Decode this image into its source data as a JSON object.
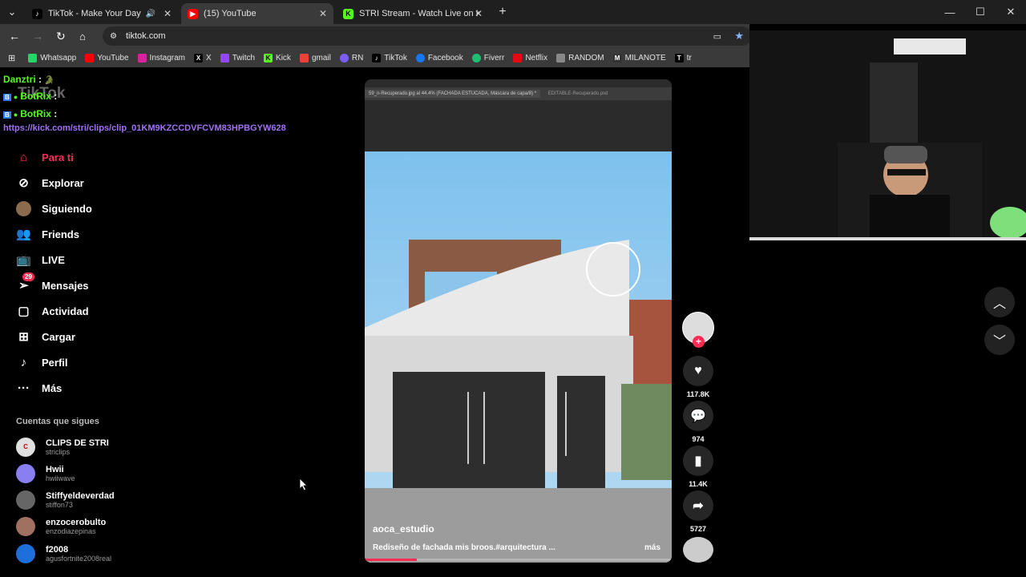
{
  "tabs": [
    {
      "title": "TikTok - Make Your Day",
      "icon": "tiktok-icon"
    },
    {
      "title": "(15) YouTube",
      "icon": "youtube-icon"
    },
    {
      "title": "STRI Stream - Watch Live on Ki",
      "icon": "kick-icon"
    }
  ],
  "url": "tiktok.com",
  "bookmarks": [
    "Whatsapp",
    "YouTube",
    "Instagram",
    "X",
    "Twitch",
    "Kick",
    "gmail",
    "RN",
    "TikTok",
    "Facebook",
    "Fiverr",
    "Netflix",
    "RANDOM",
    "MILANOTE",
    "tr"
  ],
  "chat": {
    "lines": [
      {
        "user": "Danztri",
        "text": ":"
      },
      {
        "user": "BotRix",
        "text": ":"
      },
      {
        "user": "BotRix",
        "text": ":"
      }
    ],
    "link": "https://kick.com/stri/clips/clip_01KM9KZCCDVFCVM83HPBGYW628"
  },
  "nav": [
    {
      "label": "Para ti",
      "icon": "home-icon",
      "active": true
    },
    {
      "label": "Explorar",
      "icon": "compass-icon"
    },
    {
      "label": "Siguiendo",
      "icon": "following-avatar-icon"
    },
    {
      "label": "Friends",
      "icon": "friends-icon"
    },
    {
      "label": "LIVE",
      "icon": "live-icon"
    },
    {
      "label": "Mensajes",
      "icon": "messages-icon",
      "badge": "29"
    },
    {
      "label": "Actividad",
      "icon": "activity-icon"
    },
    {
      "label": "Cargar",
      "icon": "upload-icon"
    },
    {
      "label": "Perfil",
      "icon": "profile-icon"
    },
    {
      "label": "Más",
      "icon": "more-icon"
    }
  ],
  "following": {
    "heading": "Cuentas que sigues",
    "accounts": [
      {
        "name": "CLIPS DE STRI",
        "handle": "striclips"
      },
      {
        "name": "Hwii",
        "handle": "hwiiwave"
      },
      {
        "name": "Stiffyeldeverdad",
        "handle": "stiffon73"
      },
      {
        "name": "enzocerobulto",
        "handle": "enzodiazepinas"
      },
      {
        "name": "f2008",
        "handle": "agusfortnite2008real"
      }
    ]
  },
  "video": {
    "ps_tab1": "59_n-Recuperado.jpg al 44.4% (FACHADA ESTUCADA, Máscara de capa/8) *",
    "ps_tab2": "EDITABLE-Recuperado.psd",
    "author": "aoca_estudio",
    "caption": "Rediseño de fachada mis broos.#arquitectura ...",
    "more": "más",
    "progress": 0.17
  },
  "actions": {
    "likes": "117.8K",
    "comments": "974",
    "saves": "11.4K",
    "shares": "5727"
  }
}
